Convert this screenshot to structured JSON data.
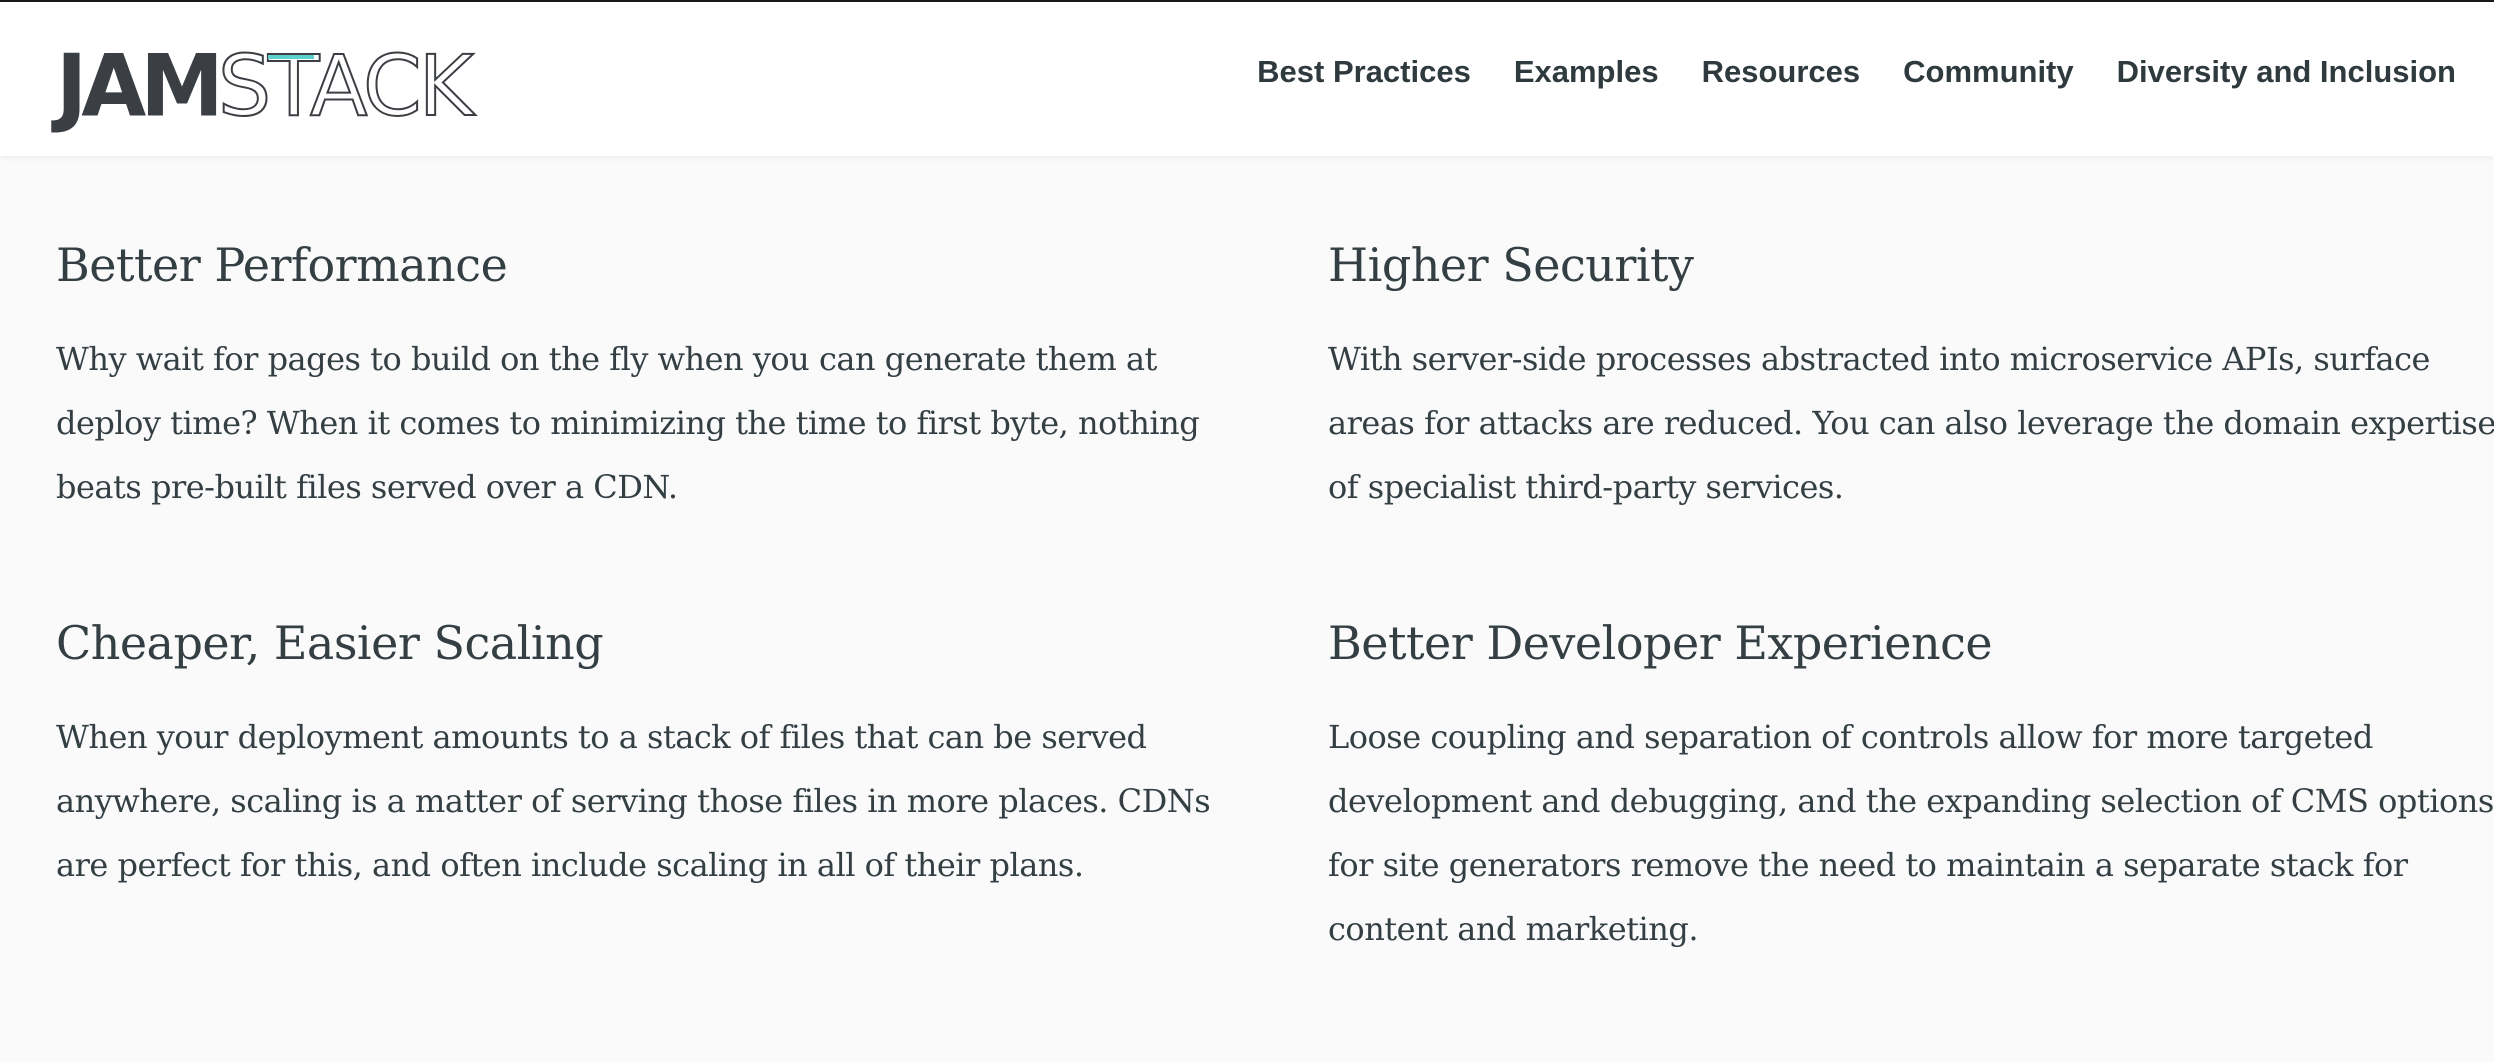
{
  "logo": {
    "part1": "JAM",
    "part2": "STACK",
    "accent_color": "#5ccfcf"
  },
  "nav": {
    "items": [
      {
        "label": "Best Practices"
      },
      {
        "label": "Examples"
      },
      {
        "label": "Resources"
      },
      {
        "label": "Community"
      },
      {
        "label": "Diversity and Inclusion"
      }
    ]
  },
  "features": [
    {
      "title": "Better Performance",
      "text": "Why wait for pages to build on the fly when you can generate them at deploy time? When it comes to minimizing the time to first byte, nothing beats pre-built files served over a CDN."
    },
    {
      "title": "Higher Security",
      "text": "With server-side processes abstracted into microservice APIs, surface areas for attacks are reduced. You can also leverage the domain expertise of specialist third-party services."
    },
    {
      "title": "Cheaper, Easier Scaling",
      "text": "When your deployment amounts to a stack of files that can be served anywhere, scaling is a matter of serving those files in more places. CDNs are perfect for this, and often include scaling in all of their plans."
    },
    {
      "title": "Better Developer Experience",
      "text": "Loose coupling and separation of controls allow for more targeted development and debugging, and the expanding selection of CMS options for site generators remove the need to maintain a separate stack for content and marketing."
    }
  ]
}
